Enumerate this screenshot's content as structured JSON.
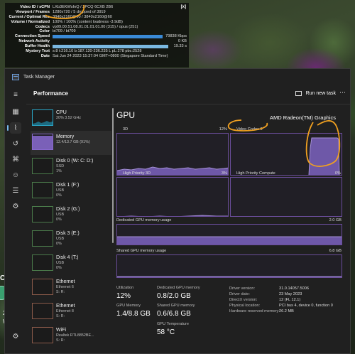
{
  "video_overlay": {
    "close_label": "[x]",
    "rows": [
      {
        "label": "Video ID / sCPN",
        "value": "LXb3EKWsInQ  /  2PCQ 6CXB 2B6"
      },
      {
        "label": "Viewport / Frames",
        "value": "1280x720 / 5 dropped of 3919"
      },
      {
        "label": "Current / Optimal Res",
        "value": "3840x2160@60 / 3840x2160@60"
      },
      {
        "label": "Volume / Normalized",
        "value": "100% / 100% (content loudness -3.9dB)"
      },
      {
        "label": "Codecs",
        "value": "vp09.00.51.08.01.01.01.01.00 (315) / opus (251)"
      },
      {
        "label": "Color",
        "value": "bt709 / bt709"
      },
      {
        "label": "Connection Speed",
        "value": "79838 Kbps",
        "bar": true,
        "bar_color": "#3a8ad6",
        "bar_fill": 1.0
      },
      {
        "label": "Network Activity",
        "value": "0 KB",
        "bar": true,
        "bar_color": "#c04070",
        "bar_fill": 0.0
      },
      {
        "label": "Buffer Health",
        "value": "19.33 s",
        "bar": true,
        "bar_color": "#7ab8e0",
        "bar_fill": 0.98
      },
      {
        "label": "Mystery Text",
        "value": "s:8 t:216.10 b:187.120-236.235 L pL:278 pbc:2528"
      },
      {
        "label": "Date",
        "value": "Sat Jun 24 2023 15:37:04 GMT+0800 (Singapore Standard Time)"
      }
    ]
  },
  "background_left_text": [
    "CO",
    "24",
    "W"
  ],
  "task_manager": {
    "window_title": "Task Manager",
    "section_title": "Performance",
    "run_new_task_label": "Run new task",
    "more_label": "⋯",
    "rail_icons": [
      "hamburger-icon",
      "processes-icon",
      "performance-icon",
      "history-icon",
      "startup-icon",
      "users-icon",
      "details-icon",
      "services-icon",
      "settings-icon"
    ],
    "devices": [
      {
        "name": "CPU",
        "sub1": "20%  3.52 GHz",
        "sub2": "",
        "kind": "cpu"
      },
      {
        "name": "Memory",
        "sub1": "12.4/13.7 GB (91%)",
        "sub2": "",
        "kind": "memory"
      },
      {
        "name": "Disk 0 (W: C: D:)",
        "sub1": "SSD",
        "sub2": "1%",
        "kind": "disk"
      },
      {
        "name": "Disk 1 (F:)",
        "sub1": "USB",
        "sub2": "0%",
        "kind": "disk"
      },
      {
        "name": "Disk 2 (G:)",
        "sub1": "USB",
        "sub2": "0%",
        "kind": "disk"
      },
      {
        "name": "Disk 3 (E:)",
        "sub1": "USB",
        "sub2": "0%",
        "kind": "disk"
      },
      {
        "name": "Disk 4 (T:)",
        "sub1": "USB",
        "sub2": "0%",
        "kind": "disk"
      },
      {
        "name": "Ethernet",
        "sub1": "Ethernet 6",
        "sub2": "S: R:",
        "kind": "net"
      },
      {
        "name": "Ethernet",
        "sub1": "Ethernet 8",
        "sub2": "S: R:",
        "kind": "net"
      },
      {
        "name": "WiFi",
        "sub1": "Realtek RTL8852BE...",
        "sub2": "S: R:",
        "kind": "net"
      }
    ],
    "gpu": {
      "title": "GPU",
      "model": "AMD Radeon(TM) Graphics",
      "engines": [
        {
          "label": "3D",
          "pct": "12%"
        },
        {
          "label": "Video Codec 0",
          "pct": ""
        },
        {
          "label": "High Priority 3D",
          "pct": "3%"
        },
        {
          "label": "High Priority Compute",
          "pct": "0%"
        }
      ],
      "dedicated": {
        "label": "Dedicated GPU memory usage",
        "max": "2.0 GB"
      },
      "shared": {
        "label": "Shared GPU memory usage",
        "max": "6.8 GB"
      },
      "stats": {
        "utilization_label": "Utilization",
        "utilization": "12%",
        "dedicated_label": "Dedicated GPU memory",
        "dedicated": "0.8/2.0 GB",
        "gpu_memory_label": "GPU Memory",
        "gpu_memory": "1.4/8.8 GB",
        "shared_label": "Shared GPU memory",
        "shared": "0.6/6.8 GB",
        "temp_label": "GPU Temperature",
        "temp": "58 °C"
      },
      "driver": [
        {
          "k": "Driver version:",
          "v": "31.0.14057.5006"
        },
        {
          "k": "Driver date:",
          "v": "23 May 2023"
        },
        {
          "k": "DirectX version:",
          "v": "12 (FL 12.1)"
        },
        {
          "k": "Physical location:",
          "v": "PCI bus 4, device 0, function 0"
        },
        {
          "k": "Hardware reserved memory:",
          "v": "26.2 MB"
        }
      ]
    }
  },
  "colors": {
    "graph_line": "#a48fd6",
    "graph_fill": "#6e58a8",
    "graph_border": "#6a4d9a",
    "annotation": "#f0a020"
  }
}
